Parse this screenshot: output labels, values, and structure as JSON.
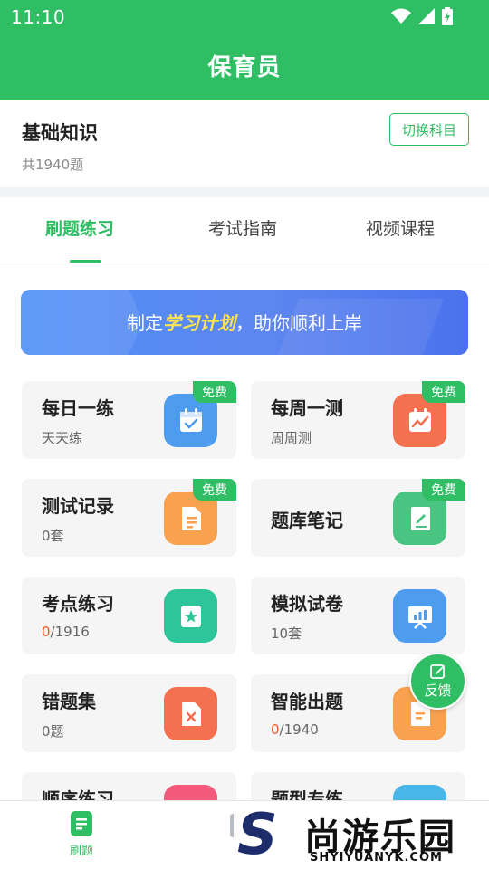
{
  "status": {
    "time": "11:10"
  },
  "header": {
    "title": "保育员"
  },
  "subject": {
    "name": "基础知识",
    "count": "共1940题",
    "switch_label": "切换科目"
  },
  "tabs": [
    {
      "label": "刷题练习",
      "active": true
    },
    {
      "label": "考试指南",
      "active": false
    },
    {
      "label": "视频课程",
      "active": false
    }
  ],
  "banner": {
    "prefix": "制定",
    "highlight": "学习计划",
    "suffix": "，助你顺利上岸"
  },
  "cards": [
    {
      "title": "每日一练",
      "sub": "天天练",
      "free": "免费",
      "icon": "calendar-icon",
      "color": "#4d9cf0"
    },
    {
      "title": "每周一测",
      "sub": "周周测",
      "free": "免费",
      "icon": "chart-icon",
      "color": "#f5704f"
    },
    {
      "title": "测试记录",
      "sub": "0套",
      "free": "免费",
      "icon": "document-icon",
      "color": "#f8a14e"
    },
    {
      "title": "题库笔记",
      "sub": "",
      "free": "免费",
      "icon": "notebook-icon",
      "color": "#49c481"
    },
    {
      "title": "考点练习",
      "sub_highlight": "0",
      "sub_rest": "/1916",
      "icon": "star-icon",
      "color": "#2fc59a"
    },
    {
      "title": "模拟试卷",
      "sub": "10套",
      "icon": "presentation-icon",
      "color": "#4d9cf0"
    },
    {
      "title": "错题集",
      "sub": "0题",
      "icon": "error-doc-icon",
      "color": "#f5704f"
    },
    {
      "title": "智能出题",
      "sub_highlight": "0",
      "sub_rest": "/1940",
      "icon": "smart-doc-icon",
      "color": "#f8a14e"
    },
    {
      "title": "顺序练习",
      "icon": "order-icon",
      "color": "#f25b7c"
    },
    {
      "title": "题型专练",
      "icon": "type-icon",
      "color": "#49b6e8"
    }
  ],
  "feedback": {
    "label": "反馈"
  },
  "bottom_nav": {
    "items": [
      {
        "label": "刷题",
        "active": true
      }
    ]
  },
  "watermark": {
    "s": "S",
    "cn": "尚游乐园",
    "en": "SHYIYUANYK.COM"
  }
}
